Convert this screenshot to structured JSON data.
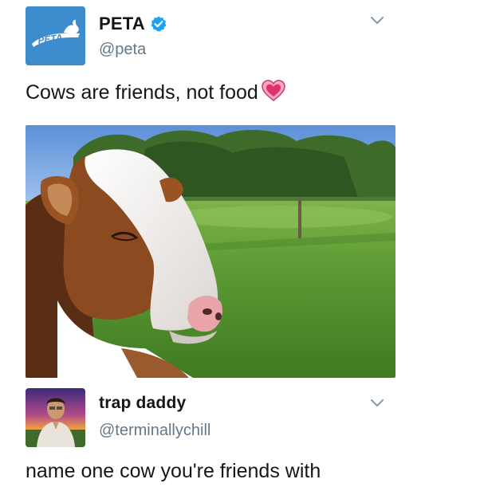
{
  "tweet1": {
    "display_name": "PETA",
    "handle": "@peta",
    "avatar_logo_text": "PETA",
    "text": "Cows are friends, not food",
    "emoji": "heart-emoji",
    "media": "cow-in-field-photo",
    "verified": true
  },
  "tweet2": {
    "display_name": "trap daddy",
    "handle": "@terminallychill",
    "text": "name one cow you're friends with"
  },
  "colors": {
    "peta_blue": "#3d8dce",
    "verified_blue": "#1da1f2",
    "handle_gray": "#657786",
    "text": "#14171a"
  }
}
